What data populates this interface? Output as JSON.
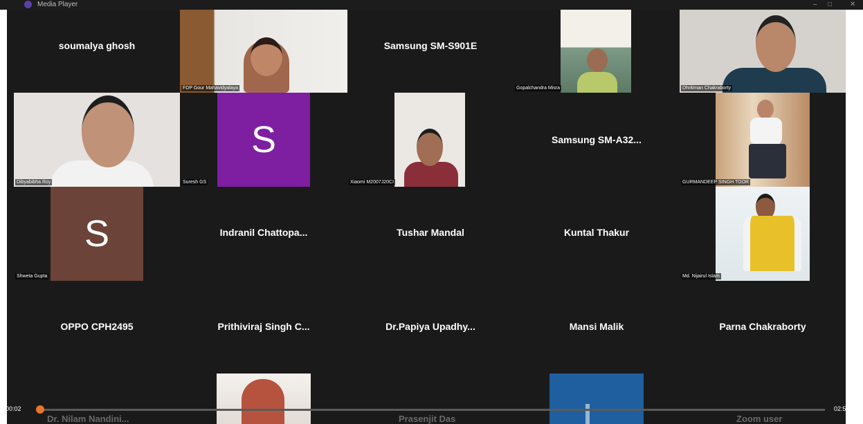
{
  "window": {
    "title": "Media Player",
    "minimize": "–",
    "restore": "□",
    "close": "✕"
  },
  "tiles": [
    {
      "name": "soumalya ghosh"
    },
    {
      "label": "FDP Gour Mahavidyalaya"
    },
    {
      "name": "Samsung SM-S901E"
    },
    {
      "label": "Gopalchandra Misra"
    },
    {
      "label": "Dhritiman Chakraborty"
    },
    {
      "label": "Dibyabibha Roy"
    },
    {
      "label": "Suresh GS",
      "avatar_letter": "S",
      "avatar_color": "#7e1fa2"
    },
    {
      "label": "Xiaomi M2007J20CI"
    },
    {
      "name": "Samsung  SM-A32..."
    },
    {
      "label": "GURMANDEEP SINGH TOOR"
    },
    {
      "label": "Shweta Gupta",
      "avatar_letter": "S",
      "avatar_color": "#6b4338"
    },
    {
      "name": "Indranil  Chattopa..."
    },
    {
      "name": "Tushar Mandal"
    },
    {
      "name": "Kuntal Thakur"
    },
    {
      "label": "Md. Nijairul Islam"
    },
    {
      "name": "OPPO CPH2495"
    },
    {
      "name": "Prithiviraj Singh C..."
    },
    {
      "name": "Dr.Papiya  Upadhy..."
    },
    {
      "name": "Mansi Malik"
    },
    {
      "name": "Parna Chakraborty"
    }
  ],
  "bottom_row": [
    {
      "name": "Dr. Nilam  Nandini..."
    },
    {
      "name": "Prasenjit Das"
    },
    {
      "name": "Zoom user"
    }
  ],
  "player": {
    "elapsed": "00:02",
    "total": "02:57:38",
    "progress": 0.001
  },
  "colors": {
    "background": "#1a1a1a",
    "accent": "#e9752a"
  }
}
